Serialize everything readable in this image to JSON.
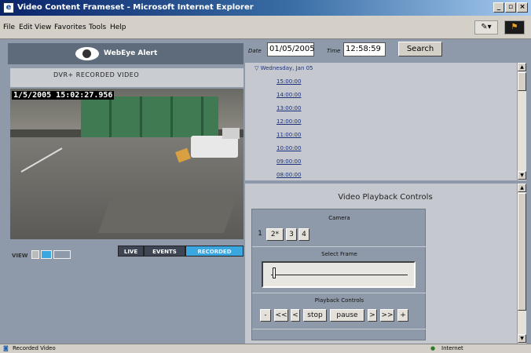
{
  "window": {
    "title": "Video Content Frameset - Microsoft Internet Explorer",
    "minimize": "_",
    "maximize": "▫",
    "close": "×"
  },
  "menu": [
    "File",
    "Edit",
    "View",
    "Favorites",
    "Tools",
    "Help"
  ],
  "brand": {
    "name": "WebEye Alert"
  },
  "video": {
    "header": "DVR+ RECORDED VIDEO",
    "timestamp": "1/5/2005 15:02:27.956"
  },
  "view": {
    "label": "VIEW"
  },
  "modes": {
    "live": "LIVE",
    "events": "EVENTS",
    "recorded": "RECORDED"
  },
  "search": {
    "date_label": "Date",
    "date_value": "01/05/2005",
    "time_label": "Time",
    "time_value": "12:58:59",
    "button": "Search"
  },
  "timelist": {
    "day": "Wednesday, Jan 05",
    "slots": [
      "15:00:00",
      "14:00:00",
      "13:00:00",
      "12:00:00",
      "11:00:00",
      "10:00:00",
      "09:00:00",
      "08:00:00"
    ]
  },
  "playback": {
    "title": "Video Playback Controls",
    "camera_label": "Camera",
    "cameras": [
      "1",
      "2",
      "3",
      "4"
    ],
    "camera_selected_marker": "*",
    "select_frame_label": "Select Frame",
    "controls_label": "Playback Controls",
    "buttons": [
      "-",
      "<<",
      "<",
      "stop",
      "pause",
      ">",
      ">>",
      "+"
    ]
  },
  "status": {
    "text": "Recorded Video",
    "zone": "Internet"
  }
}
